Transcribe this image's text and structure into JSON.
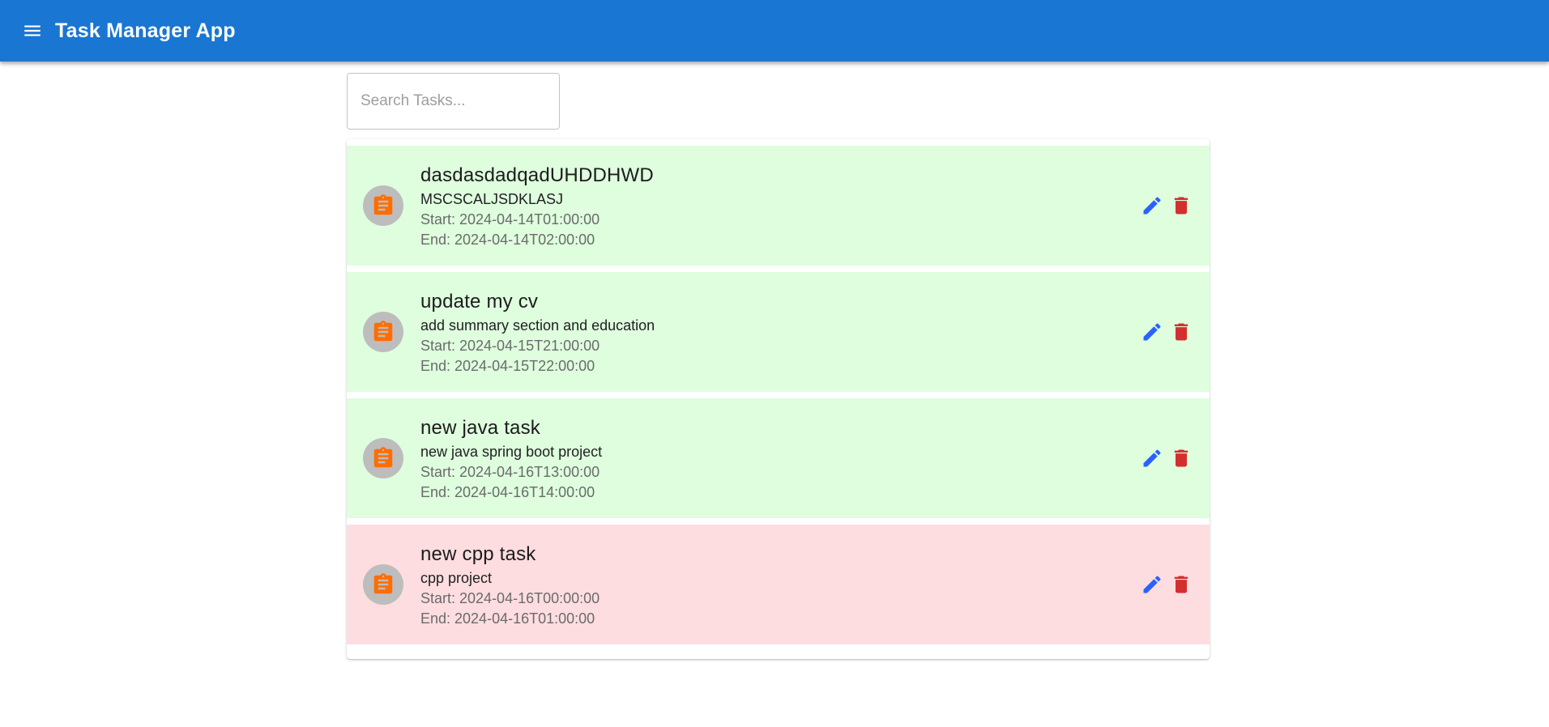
{
  "app": {
    "title": "Task Manager App",
    "menu_icon": "menu-icon",
    "colors": {
      "appbar": "#1976d2",
      "completed_row": "#defede",
      "overdue_row": "#fddde0",
      "task_icon": "#ff6d00",
      "edit_icon": "#2962ff",
      "delete_icon": "#d32f2f",
      "avatar_bg": "#bdbdbd"
    }
  },
  "search": {
    "placeholder": "Search Tasks...",
    "value": ""
  },
  "tasks": [
    {
      "title": "dasdasdadqadUHDDHWD",
      "description": "MSCSCALJSDKLASJ",
      "start": "Start: 2024-04-14T01:00:00",
      "end": "End: 2024-04-14T02:00:00",
      "status": "completed",
      "icon": "assignment-icon"
    },
    {
      "title": "update my cv",
      "description": "add summary section and education",
      "start": "Start: 2024-04-15T21:00:00",
      "end": "End: 2024-04-15T22:00:00",
      "status": "completed",
      "icon": "assignment-icon"
    },
    {
      "title": "new java task",
      "description": "new java spring boot project",
      "start": "Start: 2024-04-16T13:00:00",
      "end": "End: 2024-04-16T14:00:00",
      "status": "completed",
      "icon": "assignment-icon"
    },
    {
      "title": "new cpp task",
      "description": "cpp project",
      "start": "Start: 2024-04-16T00:00:00",
      "end": "End: 2024-04-16T01:00:00",
      "status": "overdue",
      "icon": "assignment-icon"
    }
  ],
  "actions": {
    "edit_icon": "edit-icon",
    "delete_icon": "delete-icon"
  }
}
